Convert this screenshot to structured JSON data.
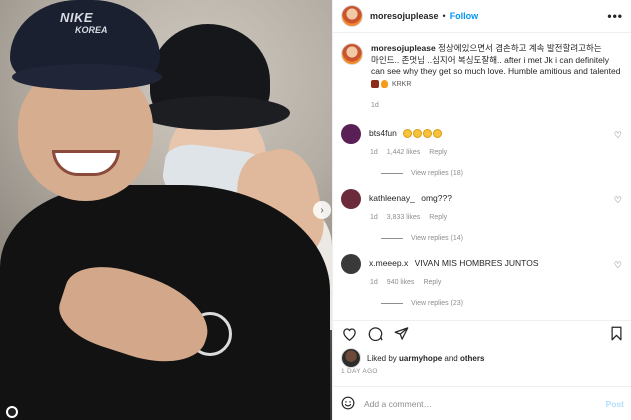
{
  "photo": {
    "cap_text_line1": "NIKE",
    "cap_text_line2": "KOREA"
  },
  "header": {
    "username": "moresojuplease",
    "separator": "•",
    "follow_label": "Follow",
    "more_label": "•••"
  },
  "caption": {
    "username": "moresojuplease",
    "text_line1": "정상에있으면서 겸손하고 계속 발전할려고하는",
    "text_line2": "마인드.. 존멋님 ..심지어 복싱도잘해.. after i met Jk i can definitely",
    "text_line3": "can see why they get so much love. Humble amitious and talented",
    "text_line4": "KRKR",
    "time": "1d"
  },
  "comments": [
    {
      "username": "bts4fun",
      "text": "",
      "emoji_count": 4,
      "time": "1d",
      "likes": "1,442 likes",
      "reply_label": "Reply",
      "view_replies": "View replies (18)",
      "avatar_color": "#5a1f55"
    },
    {
      "username": "kathleenay_",
      "text": "omg???",
      "time": "1d",
      "likes": "3,833 likes",
      "reply_label": "Reply",
      "view_replies": "View replies (14)",
      "avatar_color": "#6b2b3a"
    },
    {
      "username": "x.meeep.x",
      "text": "VIVAN MIS HOMBRES JUNTOS",
      "time": "1d",
      "likes": "940 likes",
      "reply_label": "Reply",
      "view_replies": "View replies (23)",
      "avatar_color": "#3a3a3a"
    }
  ],
  "likes": {
    "prefix": "Liked by",
    "user": "uarmyhope",
    "middle": "and",
    "others": "others"
  },
  "date": "1 DAY AGO",
  "comment_box": {
    "placeholder": "Add a comment…",
    "post_label": "Post"
  },
  "colors": {
    "accent": "#0095f6",
    "post_disabled": "#b2dffc",
    "muted": "#8e8e8e"
  }
}
